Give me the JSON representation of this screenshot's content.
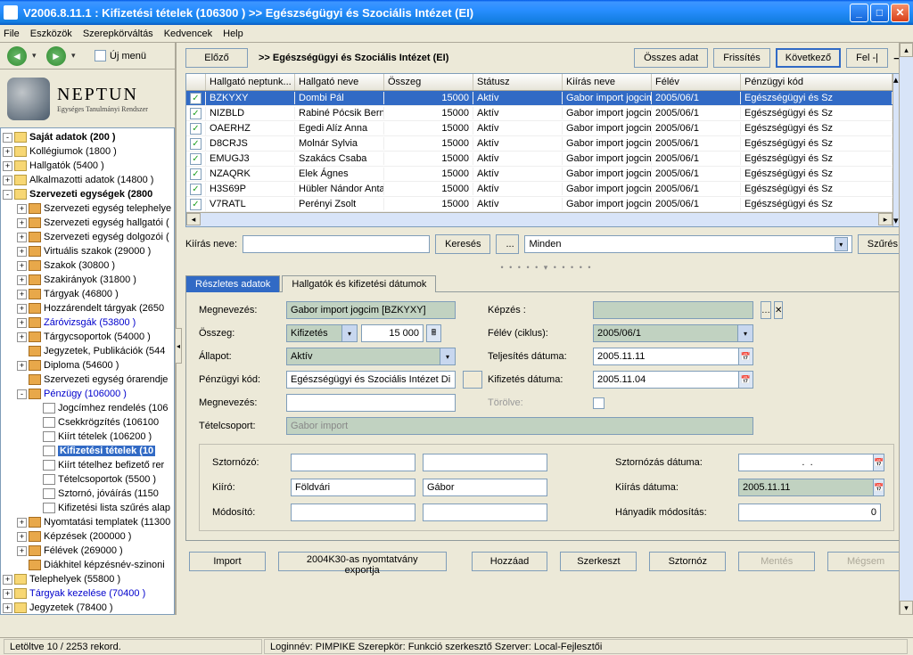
{
  "title": "V2006.8.11.1 : Kifizetési tételek (106300  )   >> Egészségügyi és Szociális Intézet (EI)",
  "menu": {
    "file": "File",
    "eszkozok": "Eszközök",
    "szerepkor": "Szerepkörváltás",
    "kedvencek": "Kedvencek",
    "help": "Help"
  },
  "uj_menu": "Új menü",
  "logo": {
    "name": "NEPTUN",
    "tagline": "Egységes Tanulmányi Rendszer"
  },
  "tree": [
    {
      "d": 0,
      "e": "-",
      "i": "folder",
      "b": true,
      "t": "Saját adatok (200  )"
    },
    {
      "d": 0,
      "e": "+",
      "i": "folder",
      "t": "Kollégiumok (1800  )"
    },
    {
      "d": 0,
      "e": "+",
      "i": "folder",
      "t": "Hallgatók (5400  )"
    },
    {
      "d": 0,
      "e": "+",
      "i": "folder",
      "t": "Alkalmazotti adatok (14800  )"
    },
    {
      "d": 0,
      "e": "-",
      "i": "folder",
      "b": true,
      "t": "Szervezeti egységek (2800"
    },
    {
      "d": 1,
      "e": "+",
      "i": "form",
      "t": "Szervezeti egység telephelye"
    },
    {
      "d": 1,
      "e": "+",
      "i": "form",
      "t": "Szervezeti egység hallgatói ("
    },
    {
      "d": 1,
      "e": "+",
      "i": "form",
      "t": "Szervezeti egység dolgozói ("
    },
    {
      "d": 1,
      "e": "+",
      "i": "form",
      "t": "Virtuális szakok (29000  )"
    },
    {
      "d": 1,
      "e": "+",
      "i": "form",
      "t": "Szakok (30800  )"
    },
    {
      "d": 1,
      "e": "+",
      "i": "form",
      "t": "Szakirányok (31800  )"
    },
    {
      "d": 1,
      "e": "+",
      "i": "form",
      "t": "Tárgyak (46800  )"
    },
    {
      "d": 1,
      "e": "+",
      "i": "form",
      "t": "Hozzárendelt tárgyak (2650"
    },
    {
      "d": 1,
      "e": "+",
      "i": "form",
      "c": "blue",
      "t": "Záróvizsgák (53800  )"
    },
    {
      "d": 1,
      "e": "+",
      "i": "form",
      "t": "Tárgycsoportok (54000  )"
    },
    {
      "d": 1,
      "e": " ",
      "i": "form",
      "t": "Jegyzetek, Publikációk (544"
    },
    {
      "d": 1,
      "e": "+",
      "i": "form",
      "t": "Diploma (54600  )"
    },
    {
      "d": 1,
      "e": " ",
      "i": "form",
      "t": "Szervezeti egység órarendje"
    },
    {
      "d": 1,
      "e": "-",
      "i": "form",
      "c": "blue",
      "t": "Pénzügy (106000  )"
    },
    {
      "d": 2,
      "e": " ",
      "i": "doc",
      "t": "Jogcímhez rendelés (106"
    },
    {
      "d": 2,
      "e": " ",
      "i": "doc",
      "t": "Csekkrögzítés (106100"
    },
    {
      "d": 2,
      "e": " ",
      "i": "doc",
      "t": "Kiírt tételek (106200  )"
    },
    {
      "d": 2,
      "e": " ",
      "i": "doc",
      "sel": true,
      "t": "Kifizetési tételek (10"
    },
    {
      "d": 2,
      "e": " ",
      "i": "doc",
      "t": "Kiírt tételhez befizető rer"
    },
    {
      "d": 2,
      "e": " ",
      "i": "doc",
      "t": "Tételcsoportok (5500  )"
    },
    {
      "d": 2,
      "e": " ",
      "i": "doc",
      "t": "Sztornó, jóváírás (1150"
    },
    {
      "d": 2,
      "e": " ",
      "i": "doc",
      "t": "Kifizetési lista szűrés alap"
    },
    {
      "d": 1,
      "e": "+",
      "i": "form",
      "t": "Nyomtatási templatek (11300"
    },
    {
      "d": 1,
      "e": "+",
      "i": "form",
      "t": "Képzések (200000  )"
    },
    {
      "d": 1,
      "e": "+",
      "i": "form",
      "t": "Félévek (269000  )"
    },
    {
      "d": 1,
      "e": " ",
      "i": "form",
      "t": "Diákhitel képzésnév-szinoni"
    },
    {
      "d": 0,
      "e": "+",
      "i": "folder",
      "t": "Telephelyek (55800  )"
    },
    {
      "d": 0,
      "e": "+",
      "i": "folder",
      "c": "blue",
      "t": "Tárgyak kezelése (70400  )"
    },
    {
      "d": 0,
      "e": "+",
      "i": "folder",
      "t": "Jegyzetek (78400  )"
    }
  ],
  "nav": {
    "elozo": "Előző",
    "osszes": "Összes adat",
    "frissites": "Frissítés",
    "kovetkezo": "Következő",
    "fel": "Fel -|"
  },
  "crumb": ">>  Egészségügyi és Szociális Intézet (EI)",
  "grid": {
    "headers": [
      "Hallgató neptunk...",
      "Hallgató neve",
      "Összeg",
      "Státusz",
      "Kiírás neve",
      "Félév",
      "Pénzügyi kód"
    ],
    "rows": [
      {
        "sel": true,
        "c": [
          "BZKYXY",
          "Dombi Pál",
          "15000",
          "Aktív",
          "Gabor import jogcim",
          "2005/06/1",
          "Egészségügyi és Sz"
        ]
      },
      {
        "c": [
          "NIZBLD",
          "Rabiné Pócsik Bern",
          "15000",
          "Aktív",
          "Gabor import jogcim",
          "2005/06/1",
          "Egészségügyi és Sz"
        ]
      },
      {
        "c": [
          "OAERHZ",
          "Egedi Alíz Anna",
          "15000",
          "Aktív",
          "Gabor import jogcim",
          "2005/06/1",
          "Egészségügyi és Sz"
        ]
      },
      {
        "c": [
          "D8CRJS",
          "Molnár Sylvia",
          "15000",
          "Aktív",
          "Gabor import jogcim",
          "2005/06/1",
          "Egészségügyi és Sz"
        ]
      },
      {
        "c": [
          "EMUGJ3",
          "Szakács Csaba",
          "15000",
          "Aktív",
          "Gabor import jogcim",
          "2005/06/1",
          "Egészségügyi és Sz"
        ]
      },
      {
        "c": [
          "NZAQRK",
          "Elek Ágnes",
          "15000",
          "Aktív",
          "Gabor import jogcim",
          "2005/06/1",
          "Egészségügyi és Sz"
        ]
      },
      {
        "c": [
          "H3S69P",
          "Hübler Nándor Anta",
          "15000",
          "Aktív",
          "Gabor import jogcim",
          "2005/06/1",
          "Egészségügyi és Sz"
        ]
      },
      {
        "c": [
          "V7RATL",
          "Perényi Zsolt",
          "15000",
          "Aktív",
          "Gabor import jogcim",
          "2005/06/1",
          "Egészségügyi és Sz"
        ]
      }
    ]
  },
  "search": {
    "label": "Kiírás neve:",
    "kereses": "Keresés",
    "dots": "...",
    "minden": "Minden",
    "szures": "Szűrés"
  },
  "tabs": {
    "t1": "Részletes adatok",
    "t2": "Hallgatók és kifizetési dátumok"
  },
  "form": {
    "megnevezes_l": "Megnevezés:",
    "megnevezes_v": "Gabor import jogcim [BZKYXY]",
    "osszeg_l": "Összeg:",
    "osszeg_tipus": "Kifizetés",
    "osszeg_v": "15 000",
    "allapot_l": "Állapot:",
    "allapot_v": "Aktív",
    "penzugyi_l": "Pénzügyi kód:",
    "penzugyi_v": "Egészségügyi és Szociális Intézet Di",
    "megnevezes2_l": "Megnevezés:",
    "tetelcsoport_l": "Tételcsoport:",
    "tetelcsoport_v": "Gabor import",
    "kepzes_l": "Képzés :",
    "felev_l": "Félév (ciklus):",
    "felev_v": "2005/06/1",
    "teljesites_l": "Teljesítés dátuma:",
    "teljesites_v": "2005.11.11",
    "kifizetes_l": "Kifizetés dátuma:",
    "kifizetes_v": "2005.11.04",
    "torolve_l": "Törölve:"
  },
  "frame": {
    "sztornozo_l": "Sztornózó:",
    "kiiro_l": "Kiíró:",
    "kiiro_vez": "Földvári",
    "kiiro_ker": "Gábor",
    "modosito_l": "Módosító:",
    "sztornozas_l": "Sztornózás dátuma:",
    "sztornozas_v": " .  .",
    "kiirasdatum_l": "Kiírás dátuma:",
    "kiirasdatum_v": "2005.11.11",
    "hanyadik_l": "Hányadik módosítás:",
    "hanyadik_v": "0"
  },
  "bottom": {
    "import": "Import",
    "export": "2004K30-as nyomtatvány exportja",
    "hozzaad": "Hozzáad",
    "szerkeszt": "Szerkeszt",
    "sztornoz": "Sztornóz",
    "mentes": "Mentés",
    "megsem": "Mégsem"
  },
  "status": {
    "left": "Letöltve 10 / 2253 rekord.",
    "right": "Loginnév: PIMPIKE   Szerepkör: Funkció szerkesztő   Szerver: Local-Fejlesztői"
  }
}
